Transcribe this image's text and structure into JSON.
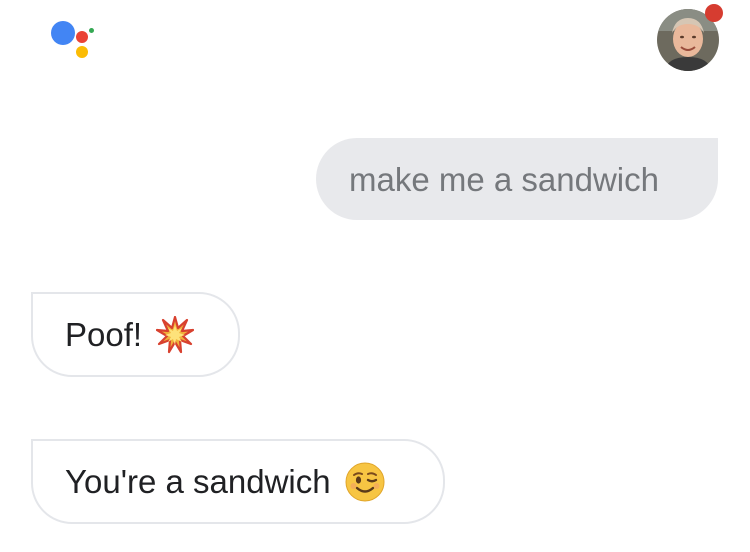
{
  "assistant_logo": {
    "icon": "google-assistant-logo",
    "colors": {
      "blue": "#4285f4",
      "red": "#ea4335",
      "yellow": "#fbbc05",
      "green": "#34a853"
    }
  },
  "user": {
    "avatar_icon": "user-avatar",
    "notification_color": "#d63c30"
  },
  "conversation": {
    "messages": [
      {
        "sender": "user",
        "text": "make me a sandwich"
      },
      {
        "sender": "assistant",
        "text": "Poof!",
        "emoji": "collision-emoji"
      },
      {
        "sender": "assistant",
        "text": "You're a sandwich",
        "emoji": "winking-face-emoji"
      }
    ]
  }
}
